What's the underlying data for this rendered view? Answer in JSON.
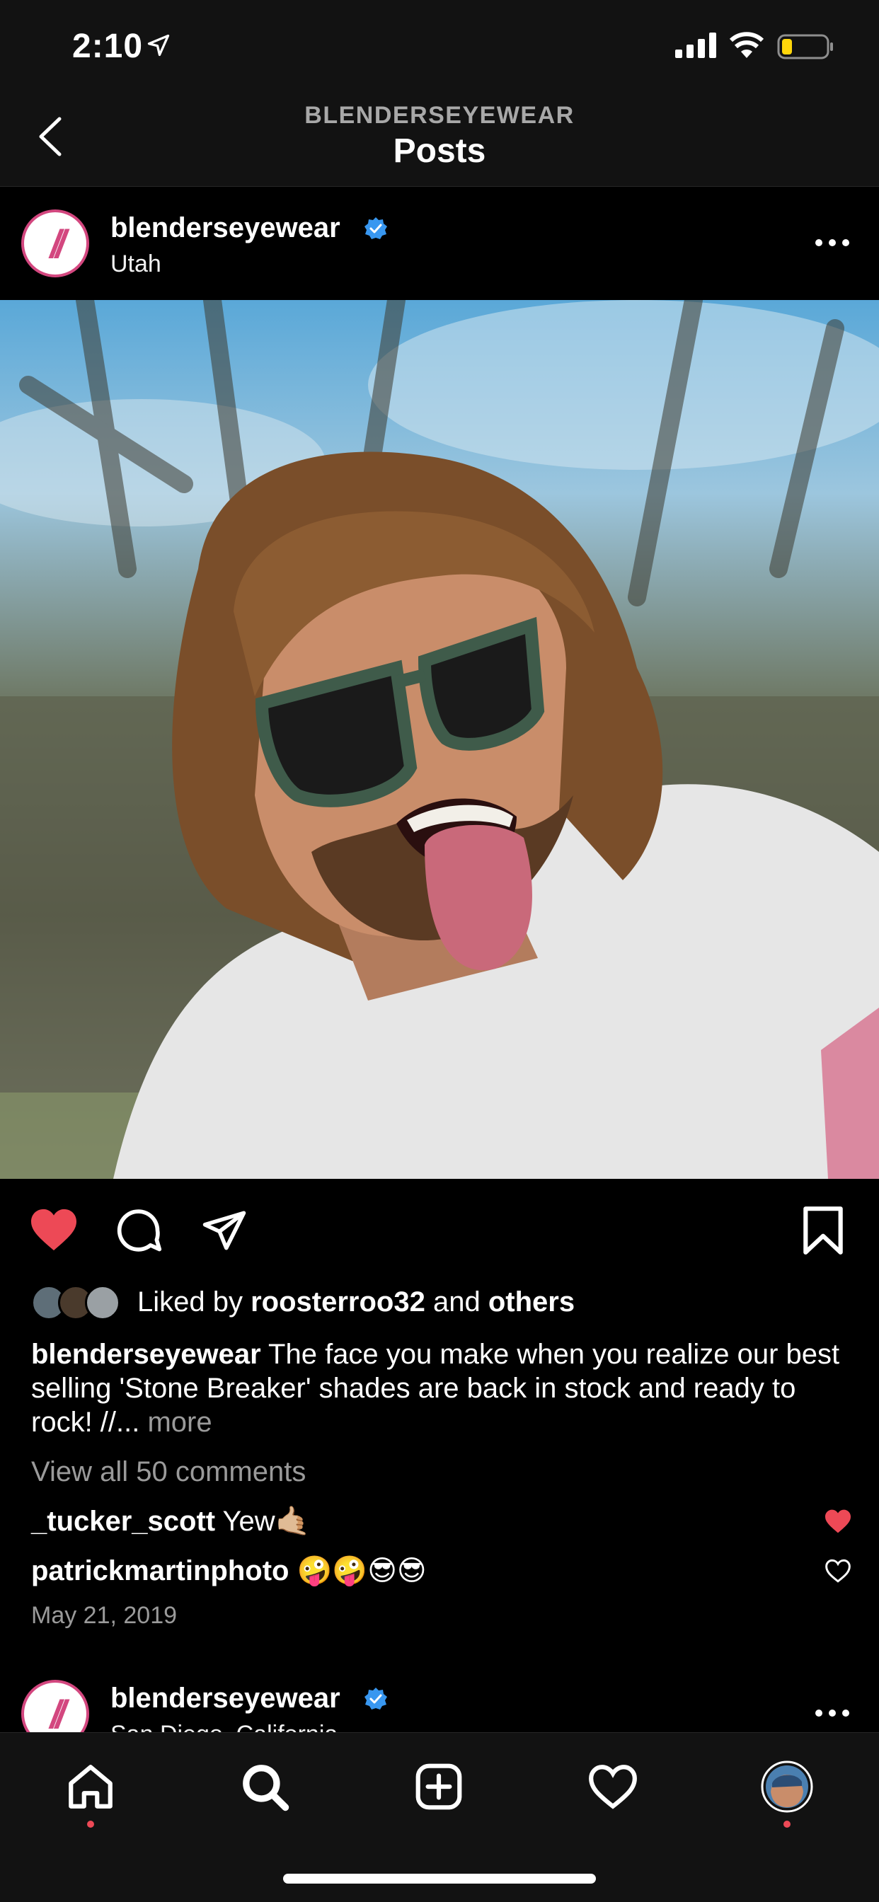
{
  "status_bar": {
    "time": "2:10"
  },
  "header": {
    "account": "BLENDERSEYEWEAR",
    "title": "Posts"
  },
  "post": {
    "username": "blenderseyewear",
    "location": "Utah",
    "liked_by": {
      "prefix": "Liked by",
      "user": "roosterroo32",
      "middle": "and",
      "others": "others"
    },
    "caption": {
      "username": "blenderseyewear",
      "text": "The face you make when you realize our best selling 'Stone Breaker' shades are back in stock and ready to rock! //...",
      "more": "more"
    },
    "view_comments": "View all 50 comments",
    "comments": [
      {
        "user": "_tucker_scott",
        "text": "Yew🤙🏼",
        "liked": true
      },
      {
        "user": "patrickmartinphoto",
        "text": "🤪🤪😎😎",
        "liked": false
      }
    ],
    "date": "May 21, 2019"
  },
  "next_post": {
    "username": "blenderseyewear",
    "location": "San Diego, California"
  },
  "colors": {
    "like_red": "#ed4956",
    "brand_pink": "#d3477f",
    "verified_blue": "#3897f0",
    "battery_yellow": "#ffd60a"
  },
  "tabs": [
    "home-icon",
    "search-icon",
    "new-post-icon",
    "activity-heart-icon",
    "profile-avatar"
  ]
}
